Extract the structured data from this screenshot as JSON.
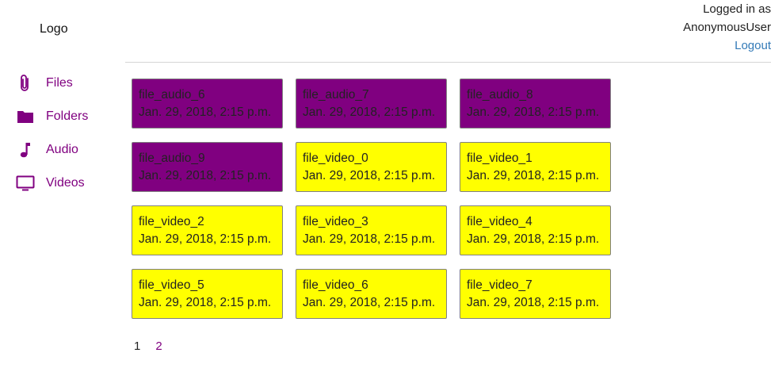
{
  "header": {
    "logo": "Logo",
    "user_line1": "Logged in as",
    "user_line2": "AnonymousUser",
    "logout": "Logout"
  },
  "sidebar": {
    "items": [
      {
        "label": "Files",
        "icon": "paperclip-icon"
      },
      {
        "label": "Folders",
        "icon": "folder-icon"
      },
      {
        "label": "Audio",
        "icon": "music-note-icon"
      },
      {
        "label": "Videos",
        "icon": "monitor-icon"
      }
    ]
  },
  "colors": {
    "accent": "#800080",
    "audio_card": "#800080",
    "video_card": "#ffff00",
    "link": "#337ab7"
  },
  "files": [
    {
      "name": "file_audio_6",
      "date": "Jan. 29, 2018, 2:15 p.m.",
      "type": "audio"
    },
    {
      "name": "file_audio_7",
      "date": "Jan. 29, 2018, 2:15 p.m.",
      "type": "audio"
    },
    {
      "name": "file_audio_8",
      "date": "Jan. 29, 2018, 2:15 p.m.",
      "type": "audio"
    },
    {
      "name": "file_audio_9",
      "date": "Jan. 29, 2018, 2:15 p.m.",
      "type": "audio"
    },
    {
      "name": "file_video_0",
      "date": "Jan. 29, 2018, 2:15 p.m.",
      "type": "video"
    },
    {
      "name": "file_video_1",
      "date": "Jan. 29, 2018, 2:15 p.m.",
      "type": "video"
    },
    {
      "name": "file_video_2",
      "date": "Jan. 29, 2018, 2:15 p.m.",
      "type": "video"
    },
    {
      "name": "file_video_3",
      "date": "Jan. 29, 2018, 2:15 p.m.",
      "type": "video"
    },
    {
      "name": "file_video_4",
      "date": "Jan. 29, 2018, 2:15 p.m.",
      "type": "video"
    },
    {
      "name": "file_video_5",
      "date": "Jan. 29, 2018, 2:15 p.m.",
      "type": "video"
    },
    {
      "name": "file_video_6",
      "date": "Jan. 29, 2018, 2:15 p.m.",
      "type": "video"
    },
    {
      "name": "file_video_7",
      "date": "Jan. 29, 2018, 2:15 p.m.",
      "type": "video"
    }
  ],
  "pagination": {
    "current": "1",
    "next": "2"
  }
}
